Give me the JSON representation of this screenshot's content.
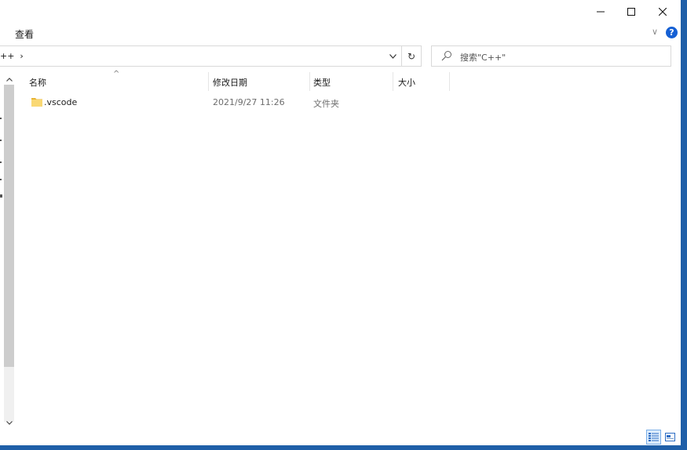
{
  "window": {
    "controls": {
      "minimize": "—",
      "maximize": "☐",
      "close": "✕"
    }
  },
  "ribbon": {
    "tab_view": "查看",
    "expand_glyph": "∨",
    "help_glyph": "?"
  },
  "address": {
    "path_text": "++  ›",
    "dropdown_glyph": "∨",
    "refresh_glyph": "↻"
  },
  "search": {
    "placeholder": "搜索\"C++\""
  },
  "columns": {
    "name": "名称",
    "modified": "修改日期",
    "type": "类型",
    "size": "大小",
    "sort_glyph": "^"
  },
  "files": [
    {
      "name": ".vscode",
      "modified": "2021/9/27 11:26",
      "type": "文件夹",
      "size": "",
      "icon": "folder-icon"
    }
  ],
  "scrollbar": {
    "up": "^",
    "down": "v"
  },
  "colors": {
    "accent": "#1f5fa8",
    "folder": "#f4c542",
    "help": "#1560d4"
  }
}
